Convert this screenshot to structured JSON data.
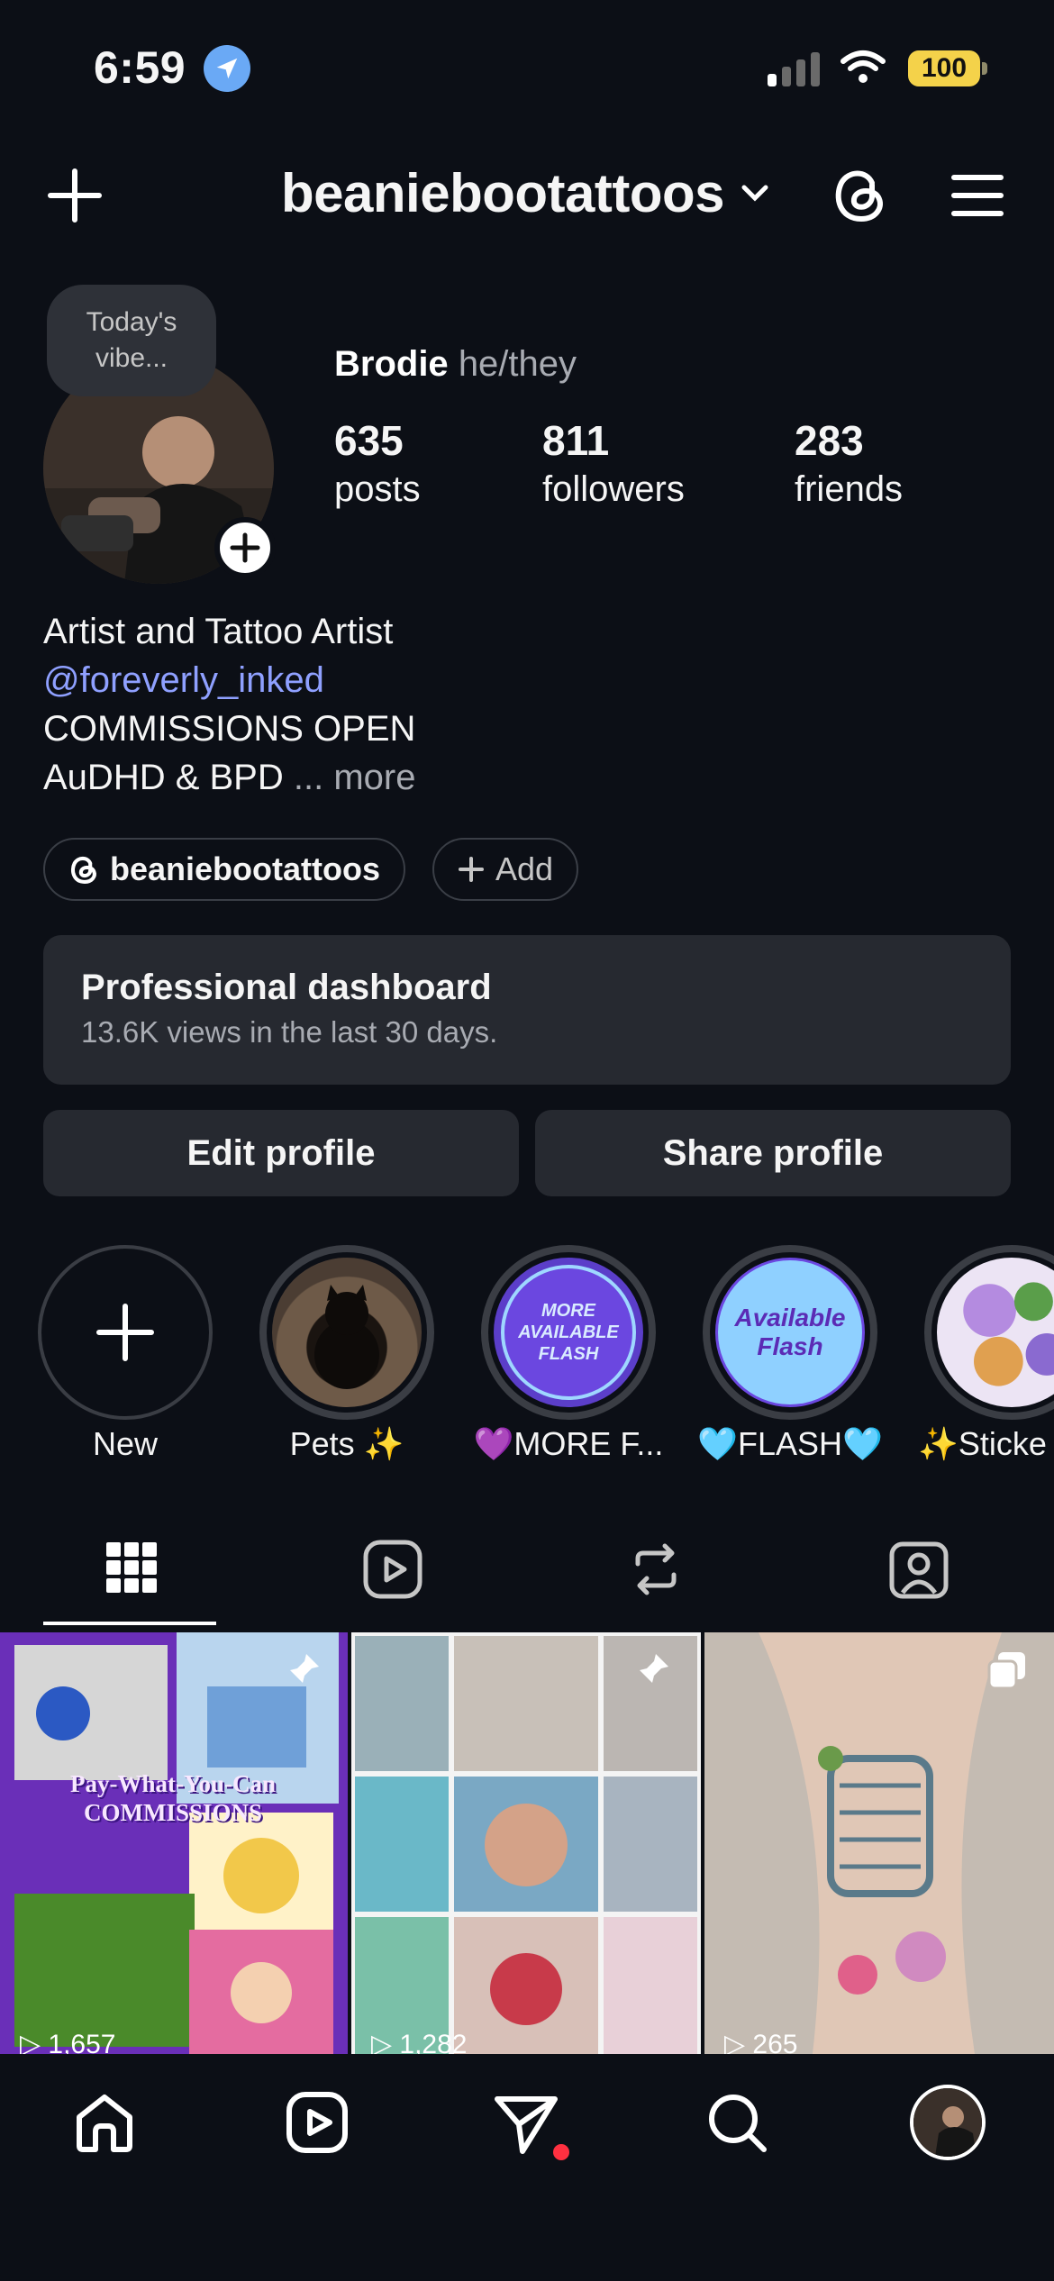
{
  "status_bar": {
    "time": "6:59",
    "battery": "100"
  },
  "header": {
    "username": "beaniebootattoos"
  },
  "profile": {
    "note": "Today's vibe...",
    "display_name": "Brodie",
    "pronouns": "he/they",
    "stats": [
      {
        "value": "635",
        "label": "posts"
      },
      {
        "value": "811",
        "label": "followers"
      },
      {
        "value": "283",
        "label": "friends"
      }
    ],
    "bio": {
      "line1": "Artist and Tattoo Artist",
      "mention": "@foreverly_inked",
      "line3": "COMMISSIONS OPEN",
      "line4": "AuDHD & BPD",
      "more": "... more"
    },
    "threads_chip": "beaniebootattoos",
    "add_chip": "Add"
  },
  "dashboard": {
    "title": "Professional dashboard",
    "subtitle": "13.6K views in the last 30 days."
  },
  "buttons": {
    "edit": "Edit profile",
    "share": "Share profile"
  },
  "highlights": [
    {
      "label": "New"
    },
    {
      "label": "Pets ✨"
    },
    {
      "label": "💜MORE F...",
      "cover_text": "MORE AVAILABLE FLASH"
    },
    {
      "label": "🩵FLASH🩵",
      "cover_text": "Available Flash"
    },
    {
      "label": "✨Sticke"
    }
  ],
  "grid": {
    "post1": {
      "caption": "Pay-What-You-Can COMMISSIONS",
      "views": "1,657"
    },
    "post2": {
      "views": "1,282"
    },
    "post3": {
      "views": "265"
    }
  },
  "colors": {
    "background": "#0c0f16",
    "surface": "#262930",
    "link": "#8fa0ff",
    "notification": "#ff3040"
  }
}
